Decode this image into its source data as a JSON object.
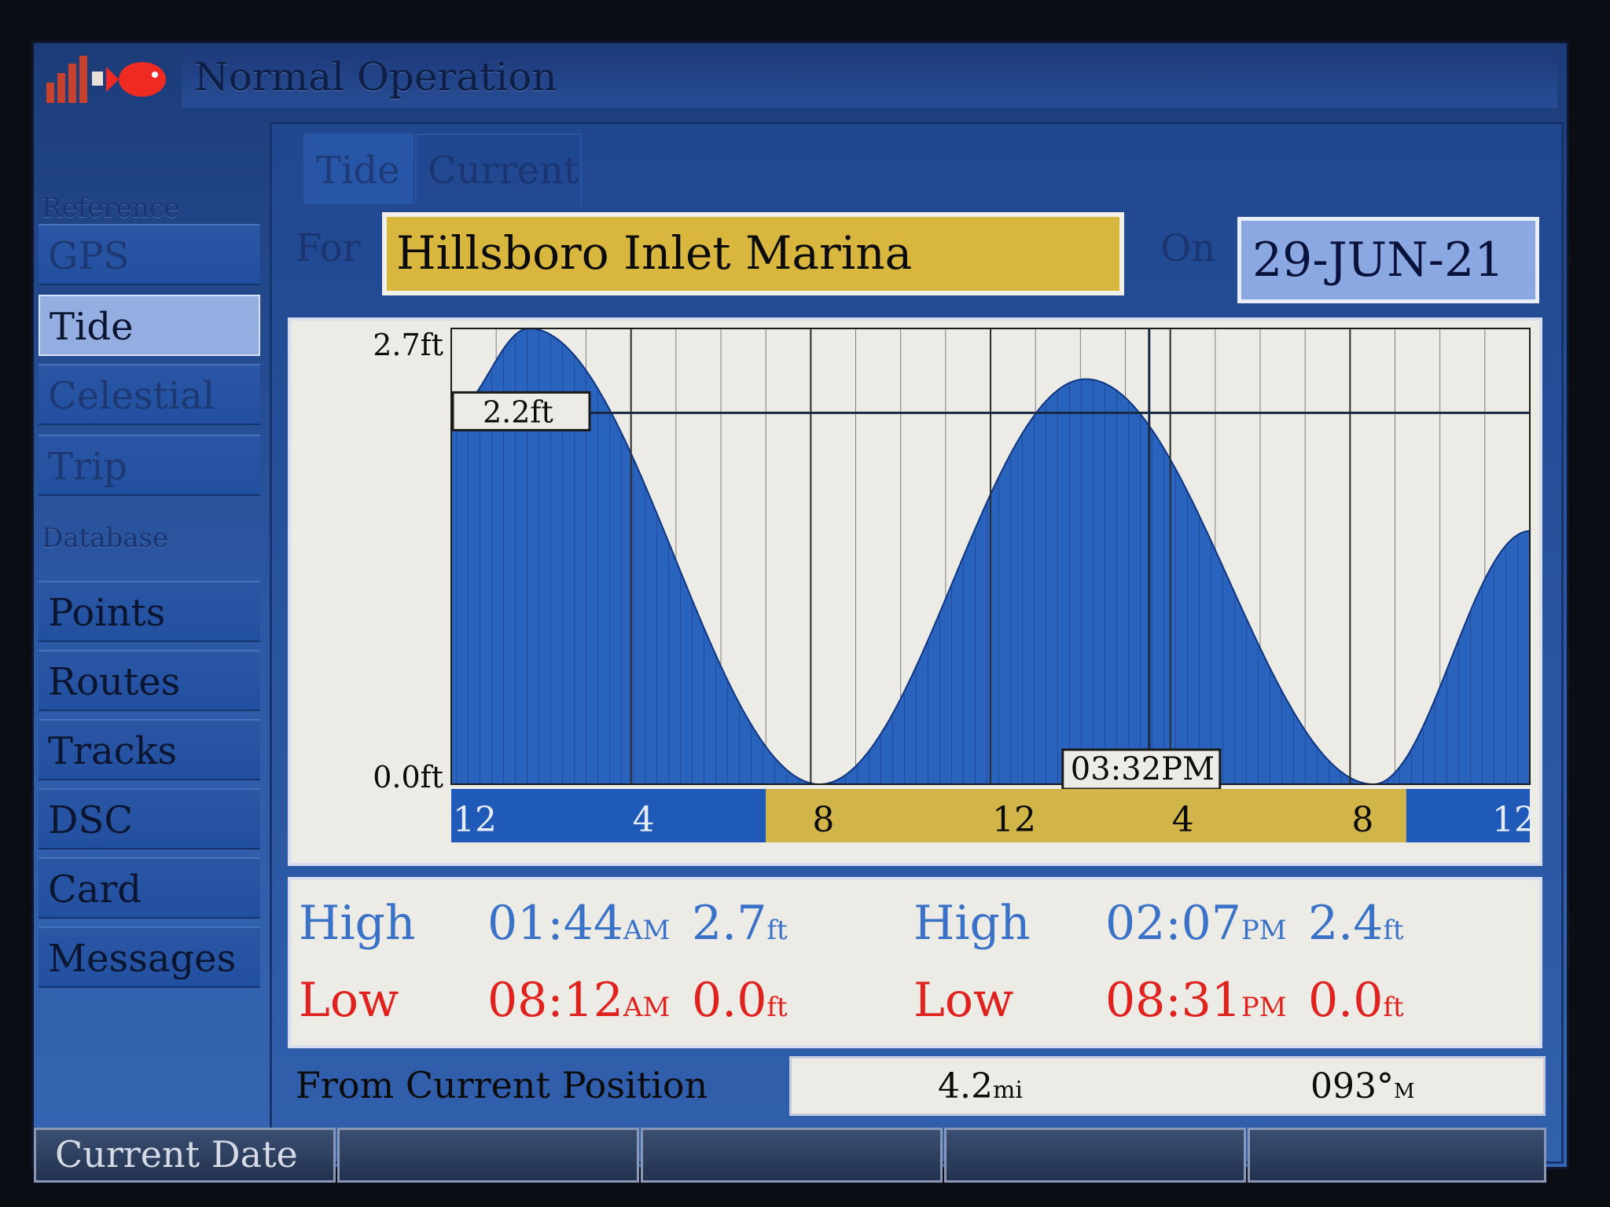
{
  "title": "Normal Operation",
  "sidebar": {
    "headers": {
      "reference": "Reference",
      "database": "Database"
    },
    "items": [
      {
        "label": "GPS"
      },
      {
        "label": "Tide"
      },
      {
        "label": "Celestial"
      },
      {
        "label": "Trip"
      },
      {
        "label": "Points"
      },
      {
        "label": "Routes"
      },
      {
        "label": "Tracks"
      },
      {
        "label": "DSC"
      },
      {
        "label": "Card"
      },
      {
        "label": "Messages"
      }
    ]
  },
  "tabs": [
    "Tide",
    "Current"
  ],
  "for_label": "For",
  "station": "Hillsboro Inlet Marina",
  "on_label": "On",
  "date": "29-JUN-21",
  "chart_data": {
    "type": "area",
    "ylabels": [
      "2.7ft",
      "0.0ft"
    ],
    "ylim": [
      0.0,
      2.7
    ],
    "xlim": [
      0,
      24
    ],
    "x_ticks": [
      "12",
      "4",
      "8",
      "12",
      "4",
      "8",
      "12"
    ],
    "cursor_level": "2.2ft",
    "cursor_time": "03:32PM",
    "x": [
      0,
      1.73,
      8.2,
      14.12,
      20.52,
      24
    ],
    "y": [
      2.2,
      2.7,
      0.0,
      2.4,
      0.0,
      1.5
    ],
    "cursor": {
      "time_hours": 15.53,
      "level_ft": 2.2
    },
    "daylight": {
      "start_hours": 7.0,
      "end_hours": 21.25
    },
    "colors": {
      "fill": "#2a63bd",
      "daylight": "#d1b548",
      "night": "#1f5ab8",
      "background": "#ecebe6"
    }
  },
  "tide_table": {
    "row1": [
      {
        "type": "High",
        "time": "01:44",
        "ampm": "AM",
        "height": "2.7",
        "unit": "ft"
      },
      {
        "type": "High",
        "time": "02:07",
        "ampm": "PM",
        "height": "2.4",
        "unit": "ft"
      }
    ],
    "row2": [
      {
        "type": "Low",
        "time": "08:12",
        "ampm": "AM",
        "height": "0.0",
        "unit": "ft"
      },
      {
        "type": "Low",
        "time": "08:31",
        "ampm": "PM",
        "height": "0.0",
        "unit": "ft"
      }
    ]
  },
  "position": {
    "label": "From Current Position",
    "distance": "4.2",
    "distance_unit": "mi",
    "bearing": "093°",
    "bearing_unit": "M"
  },
  "softkeys": [
    "Current Date",
    "",
    "",
    "",
    ""
  ]
}
